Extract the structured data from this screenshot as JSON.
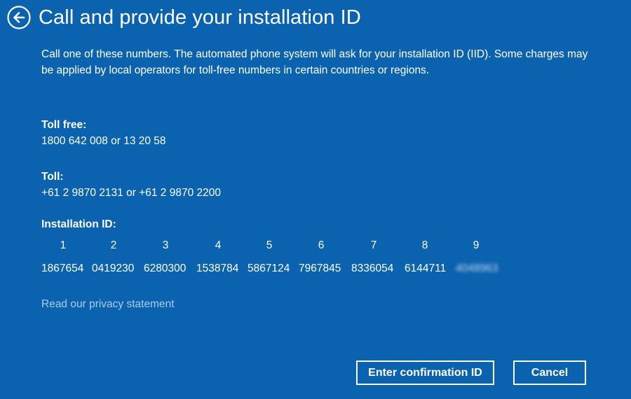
{
  "header": {
    "title": "Call and provide your installation ID",
    "back_icon": "back-arrow-icon"
  },
  "intro": {
    "text": "Call one of these numbers. The automated phone system will ask for your installation ID (IID). Some charges may be applied by local operators for toll-free numbers in certain countries or regions."
  },
  "toll_free": {
    "label": "Toll free:",
    "value": "1800 642 008 or 13 20 58"
  },
  "toll": {
    "label": "Toll:",
    "value": "+61 2 9870 2131 or +61 2 9870 2200"
  },
  "installation_id": {
    "label": "Installation ID:",
    "columns": [
      {
        "num": "1",
        "value": "1867654"
      },
      {
        "num": "2",
        "value": "0419230"
      },
      {
        "num": "3",
        "value": "6280300"
      },
      {
        "num": "4",
        "value": "1538784"
      },
      {
        "num": "5",
        "value": "5867124"
      },
      {
        "num": "6",
        "value": "7967845"
      },
      {
        "num": "7",
        "value": "8336054"
      },
      {
        "num": "8",
        "value": "6144711"
      },
      {
        "num": "9",
        "value": "4048963"
      }
    ]
  },
  "links": {
    "privacy": "Read our privacy statement"
  },
  "buttons": {
    "confirm": "Enter confirmation ID",
    "cancel": "Cancel"
  },
  "colors": {
    "background": "#0b63b0",
    "text": "#ffffff",
    "link": "#a9cdf0"
  }
}
